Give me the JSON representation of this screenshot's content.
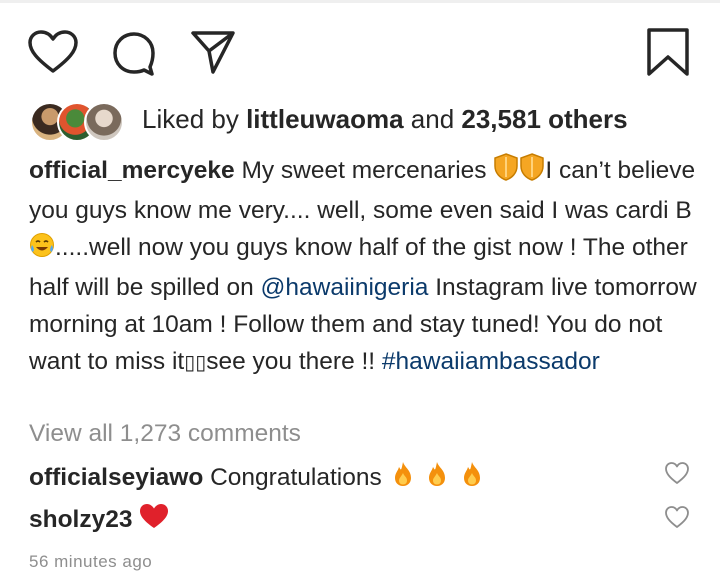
{
  "post": {
    "actions": {
      "like_icon": "heart-outline-icon",
      "comment_icon": "comment-bubble-icon",
      "share_icon": "paper-plane-icon",
      "save_icon": "bookmark-icon"
    },
    "likes": {
      "prefix": "Liked by ",
      "user": "littleuwaoma",
      "middle": " and ",
      "others": "23,581 others"
    },
    "caption": {
      "username": "official_mercyeke",
      "part1": " My sweet mercenaries ",
      "part2": "I can’t believe you guys know me very.... well, some even said I was cardi B ",
      "part3": ".....well now you guys know half of the gist now ! The other half will be spilled on ",
      "mention": "@hawaiinigeria",
      "part4": " Instagram live tomorrow morning at 10am ! Follow them and stay tuned! You do not want to miss it",
      "part5": "see you there !! ",
      "hashtag": "#hawaiiambassador"
    },
    "view_all_comments": "View all 1,273 comments",
    "comments": [
      {
        "username": "officialseyiawo",
        "text": " Congratulations "
      },
      {
        "username": "sholzy23",
        "text": " "
      }
    ],
    "timestamp": "56 minutes ago",
    "colors": {
      "text": "#262626",
      "muted": "#8e8e8e",
      "link": "#0b3a6b",
      "heart_red": "#e0212b"
    }
  }
}
